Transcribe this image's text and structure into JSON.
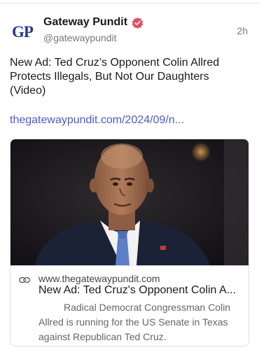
{
  "account": {
    "avatar_text": "GP",
    "display_name": "Gateway Pundit",
    "handle": "@gatewaypundit",
    "timestamp": "2h",
    "verified_icon": "verified-badge-icon"
  },
  "post": {
    "text": "New Ad: Ted Cruz’s Opponent Colin Allred Protects Illegals, But Not Our Daughters (Video)",
    "link_text": "thegatewaypundit.com/2024/09/n..."
  },
  "link_card": {
    "image_icon": "man-portrait-image",
    "link_icon": "link-icon",
    "domain": "www.thegatewaypundit.com",
    "title": "New Ad: Ted Cruz's Opponent Colin A...",
    "description": "Radical Democrat Congressman Colin Allred is running for the US Senate in Texas against Republican Ted Cruz."
  },
  "colors": {
    "link": "#4a5bd4",
    "verified": "#e8495a",
    "avatar": "#1f3d8c"
  }
}
